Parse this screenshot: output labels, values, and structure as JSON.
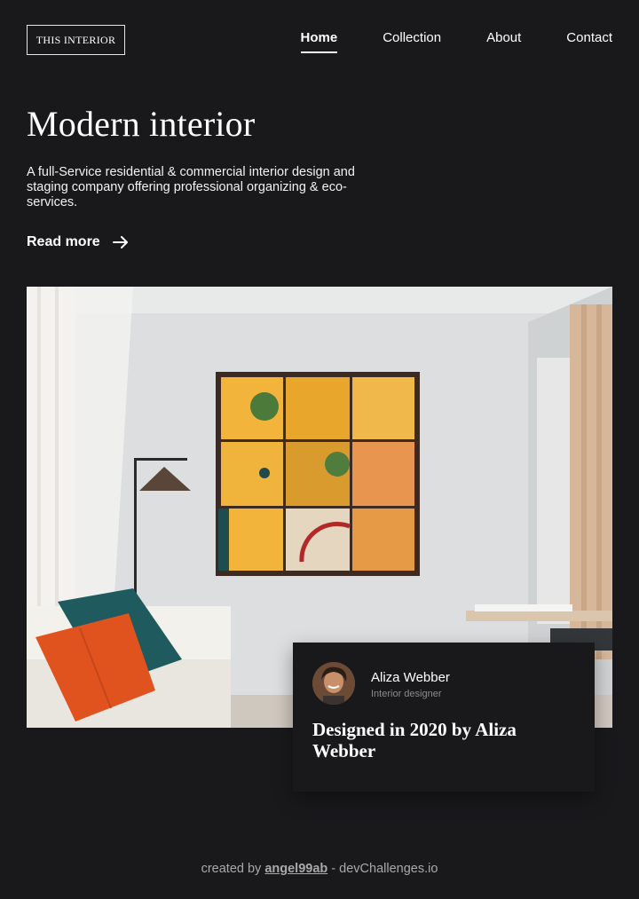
{
  "header": {
    "logo_text": "THIS INTERIOR",
    "nav": [
      {
        "label": "Home",
        "active": true
      },
      {
        "label": "Collection",
        "active": false
      },
      {
        "label": "About",
        "active": false
      },
      {
        "label": "Contact",
        "active": false
      }
    ]
  },
  "hero": {
    "title": "Modern interior",
    "description": "A full-Service residential & commercial interior design and staging company offering professional organizing & eco-services.",
    "read_more_label": "Read more",
    "arrow_icon": "arrow-right-icon"
  },
  "card": {
    "designer_name": "Aliza Webber",
    "designer_role": "Interior designer",
    "title": "Designed in 2020 by Aliza Webber"
  },
  "footer": {
    "prefix": "created by",
    "author": "angel99ab",
    "suffix": "- devChallenges.io"
  },
  "colors": {
    "background": "#19191c",
    "text": "#ffffff",
    "muted": "#8c8c8c"
  }
}
